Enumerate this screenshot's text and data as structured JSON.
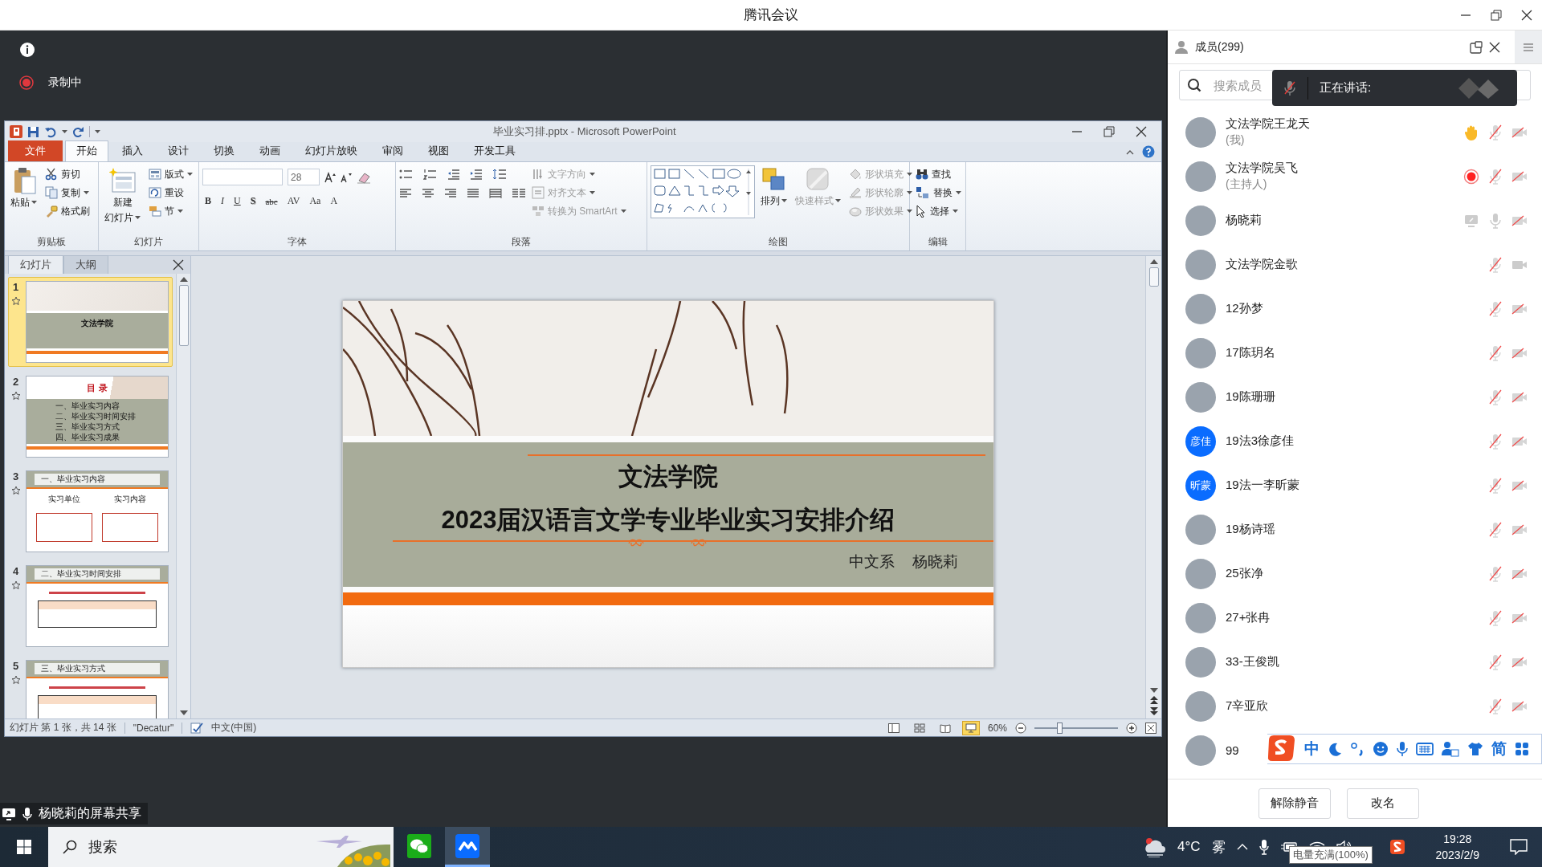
{
  "app_title": "腾讯会议",
  "recording_label": "录制中",
  "share_label": "杨晓莉的屏幕共享",
  "ppt": {
    "title": "毕业实习排.pptx - Microsoft PowerPoint",
    "tabs": [
      {
        "label": "文件",
        "kind": "file",
        "selected": false
      },
      {
        "label": "开始",
        "kind": "tab",
        "selected": true
      },
      {
        "label": "插入",
        "kind": "tab",
        "selected": false
      },
      {
        "label": "设计",
        "kind": "tab",
        "selected": false
      },
      {
        "label": "切换",
        "kind": "tab",
        "selected": false
      },
      {
        "label": "动画",
        "kind": "tab",
        "selected": false
      },
      {
        "label": "幻灯片放映",
        "kind": "tab",
        "selected": false
      },
      {
        "label": "审阅",
        "kind": "tab",
        "selected": false
      },
      {
        "label": "视图",
        "kind": "tab",
        "selected": false
      },
      {
        "label": "开发工具",
        "kind": "tab",
        "selected": false
      }
    ],
    "ribbon": [
      {
        "label": "剪贴板",
        "columns": [
          {
            "kind": "big",
            "lines": [
              "粘贴"
            ],
            "menu": true,
            "disabled": false
          },
          {
            "kind": "stack",
            "buttons": [
              {
                "label": "剪切",
                "menu": false,
                "disabled": false
              },
              {
                "label": "复制",
                "menu": true,
                "disabled": false
              },
              {
                "label": "格式刷",
                "menu": false,
                "disabled": false
              }
            ]
          }
        ]
      },
      {
        "label": "幻灯片",
        "columns": [
          {
            "kind": "big",
            "lines": [
              "新建",
              "幻灯片"
            ],
            "menu": true,
            "disabled": false
          },
          {
            "kind": "stack",
            "buttons": [
              {
                "label": "版式",
                "menu": true,
                "disabled": false
              },
              {
                "label": "重设",
                "menu": false,
                "disabled": false
              },
              {
                "label": "节",
                "menu": true,
                "disabled": false
              }
            ]
          }
        ]
      },
      {
        "label": "字体",
        "columns": [
          {
            "kind": "font",
            "size": "28",
            "format_buttons": [
              "B",
              "I",
              "U",
              "S",
              "abc",
              "AV",
              "Aa",
              "A"
            ]
          }
        ]
      },
      {
        "label": "段落",
        "columns": [
          {
            "kind": "paragraph"
          },
          {
            "kind": "stack",
            "buttons": [
              {
                "label": "文字方向",
                "menu": true,
                "disabled": true
              },
              {
                "label": "对齐文本",
                "menu": true,
                "disabled": true
              },
              {
                "label": "转换为 SmartArt",
                "menu": true,
                "disabled": true
              }
            ]
          }
        ]
      },
      {
        "label": "绘图",
        "columns": [
          {
            "kind": "gallery"
          },
          {
            "kind": "big",
            "lines": [
              "排列"
            ],
            "menu": true,
            "disabled": false
          },
          {
            "kind": "big",
            "lines": [
              "快速样式"
            ],
            "menu": true,
            "disabled": true
          },
          {
            "kind": "stack",
            "buttons": [
              {
                "label": "形状填充",
                "menu": true,
                "disabled": true
              },
              {
                "label": "形状轮廓",
                "menu": true,
                "disabled": true
              },
              {
                "label": "形状效果",
                "menu": true,
                "disabled": true
              }
            ]
          }
        ]
      },
      {
        "label": "编辑",
        "columns": [
          {
            "kind": "stack",
            "buttons": [
              {
                "label": "查找",
                "menu": false,
                "disabled": false
              },
              {
                "label": "替换",
                "menu": true,
                "disabled": false
              },
              {
                "label": "选择",
                "menu": true,
                "disabled": false
              }
            ]
          }
        ]
      }
    ],
    "pane_tabs": [
      {
        "label": "幻灯片",
        "selected": true
      },
      {
        "label": "大纲",
        "selected": false
      }
    ],
    "slides": [
      {
        "number": "1",
        "kind": "title",
        "selected": true,
        "heading": "文法学院"
      },
      {
        "number": "2",
        "kind": "contents",
        "selected": false,
        "heading": "目 录",
        "items": [
          "一、毕业实习内容",
          "二、毕业实习时间安排",
          "三、毕业实习方式",
          "四、毕业实习成果"
        ]
      },
      {
        "number": "3",
        "kind": "boxes",
        "selected": false,
        "heading": "一、毕业实习内容",
        "items": [
          "实习单位",
          "实习内容"
        ]
      },
      {
        "number": "4",
        "kind": "table",
        "selected": false,
        "heading": "二、毕业实习时间安排"
      },
      {
        "number": "5",
        "kind": "table",
        "selected": false,
        "heading": "三、毕业实习方式"
      }
    ],
    "slide": {
      "title": "文法学院",
      "subtitle": "2023届汉语言文学专业毕业实习安排介绍",
      "department": "中文系",
      "author": "杨晓莉"
    },
    "status": {
      "slide_info": "幻灯片 第 1 张，共 14 张",
      "theme": "\"Decatur\"",
      "language": "中文(中国)",
      "views": [
        {
          "selected": false
        },
        {
          "selected": false
        },
        {
          "selected": false
        },
        {
          "selected": true
        }
      ],
      "zoom": "60%",
      "zoom_level": {
        "level": 0.3
      }
    }
  },
  "members_panel": {
    "title": "成员(299)",
    "search_placeholder": "搜索成员",
    "speaking_label": "正在讲话:",
    "members": [
      {
        "name": "文法学院王龙天",
        "role": "(我)",
        "avatar": {
          "kind": "photo"
        },
        "kind": "hand",
        "mic_muted": true,
        "camera_off": true
      },
      {
        "name": "文法学院吴飞",
        "role": "(主持人)",
        "avatar": {
          "kind": "photo"
        },
        "kind": "recording",
        "mic_muted": true,
        "camera_off": true
      },
      {
        "name": "杨晓莉",
        "avatar": {
          "kind": "photo"
        },
        "kind": "sharing",
        "mic_muted": false,
        "camera_off": true
      },
      {
        "name": "文法学院金歌",
        "avatar": {
          "kind": "photo"
        },
        "mic_muted": true,
        "camera_off": false
      },
      {
        "name": "12孙梦",
        "avatar": {
          "kind": "photo"
        },
        "mic_muted": true,
        "camera_off": true
      },
      {
        "name": "17陈玥名",
        "avatar": {
          "kind": "photo"
        },
        "mic_muted": true,
        "camera_off": true
      },
      {
        "name": "19陈珊珊",
        "avatar": {
          "kind": "photo"
        },
        "mic_muted": true,
        "camera_off": true
      },
      {
        "name": "19法3徐彦佳",
        "avatar": {
          "kind": "initials",
          "text": "彦佳"
        },
        "mic_muted": true,
        "camera_off": true
      },
      {
        "name": "19法一李昕蒙",
        "avatar": {
          "kind": "initials",
          "text": "昕蒙"
        },
        "mic_muted": true,
        "camera_off": true
      },
      {
        "name": "19杨诗瑶",
        "avatar": {
          "kind": "photo"
        },
        "mic_muted": true,
        "camera_off": true
      },
      {
        "name": "25张净",
        "avatar": {
          "kind": "photo"
        },
        "mic_muted": true,
        "camera_off": true
      },
      {
        "name": "27+张冉",
        "avatar": {
          "kind": "photo"
        },
        "mic_muted": true,
        "camera_off": true
      },
      {
        "name": "33-王俊凯",
        "avatar": {
          "kind": "photo"
        },
        "mic_muted": true,
        "camera_off": true
      },
      {
        "name": "7辛亚欣",
        "avatar": {
          "kind": "photo"
        },
        "mic_muted": true,
        "camera_off": true
      },
      {
        "name": "99",
        "avatar": {
          "kind": "photo"
        }
      }
    ],
    "buttons": [
      "解除静音",
      "改名"
    ]
  },
  "ime_bar": {
    "mode": "中",
    "script": "简"
  },
  "taskbar": {
    "search_placeholder": "搜索",
    "apps": [
      {
        "kind": "chat",
        "active": false
      },
      {
        "kind": "meeting",
        "active": true
      }
    ],
    "temperature": "4°C",
    "weather": "雾",
    "time": "19:28",
    "date": "2023/2/9",
    "tooltip": "电量充满(100%)"
  }
}
